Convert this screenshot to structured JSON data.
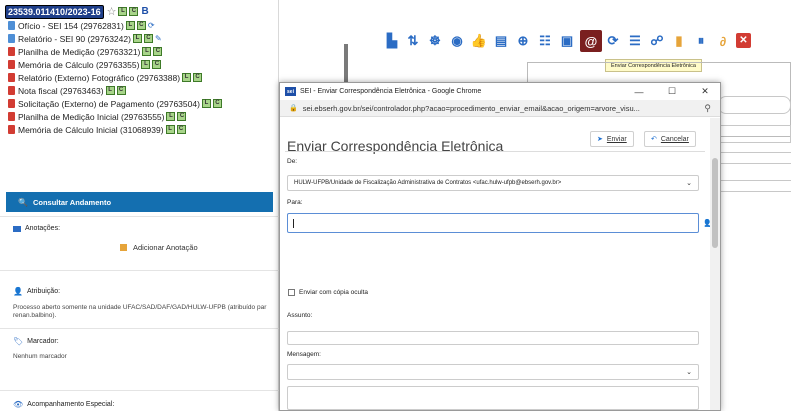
{
  "process": {
    "number": "23539.011410/2023-16",
    "star": "☆",
    "badges": [
      "L",
      "C"
    ],
    "bletter": "B"
  },
  "documents": [
    {
      "label": "Ofício - SEI 154 (29762831)",
      "color": "blue",
      "extra": "⟳"
    },
    {
      "label": "Relatório - SEI 90 (29763242)",
      "color": "blue",
      "extra": "✎"
    },
    {
      "label": "Planilha de Medição (29763321)",
      "color": "red",
      "extra": ""
    },
    {
      "label": "Memória de Cálculo (29763355)",
      "color": "red",
      "extra": ""
    },
    {
      "label": "Relatório (Externo) Fotográfico (29763388)",
      "color": "red",
      "extra": ""
    },
    {
      "label": "Nota fiscal (29763463)",
      "color": "red",
      "extra": ""
    },
    {
      "label": "Solicitação (Externo) de Pagamento (29763504)",
      "color": "red",
      "extra": ""
    },
    {
      "label": "Planilha de Medição Inicial (29763555)",
      "color": "red",
      "extra": ""
    },
    {
      "label": "Memória de Cálculo Inicial (31068939)",
      "color": "red",
      "extra": ""
    }
  ],
  "left_panel": {
    "consultar": "Consultar Andamento",
    "anotacoes_title": "Anotações:",
    "anotacao_add": "Adicionar Anotação",
    "atribuicao_title": "Atribuição:",
    "atribuicao_text_1": "Processo aberto somente na unidade UFAC/SAD/DAF/GAD/HULW-UFPB (atribuído par",
    "atribuicao_text_2": "renan.balbino).",
    "marcador_title": "Marcador:",
    "marcador_text": "Nenhum marcador",
    "acompanhamento_title": "Acompanhamento Especial:"
  },
  "tooltip": "Enviar Correspondência Eletrônica",
  "popup": {
    "window_title": "SEI - Enviar Correspondência Eletrônica - Google Chrome",
    "url": "sei.ebserh.gov.br/sei/controlador.php?acao=procedimento_enviar_email&acao_origem=arvore_visu...",
    "heading": "Enviar Correspondência Eletrônica",
    "enviar": "Enviar",
    "cancelar": "Cancelar",
    "de_label": "De:",
    "de_value": "HULW-UFPB/Unidade de Fiscalização Administrativa de Contratos <ufac.hulw-ufpb@ebserh.gov.br>",
    "para_label": "Para:",
    "cco_label": "Enviar com cópia oculta",
    "assunto_label": "Assunto:",
    "mensagem_label": "Mensagem:"
  },
  "colors": {
    "sei_blue": "#146fb0",
    "process_badge": "#1f3f8a",
    "tooltip_bg": "#fffbc9"
  }
}
